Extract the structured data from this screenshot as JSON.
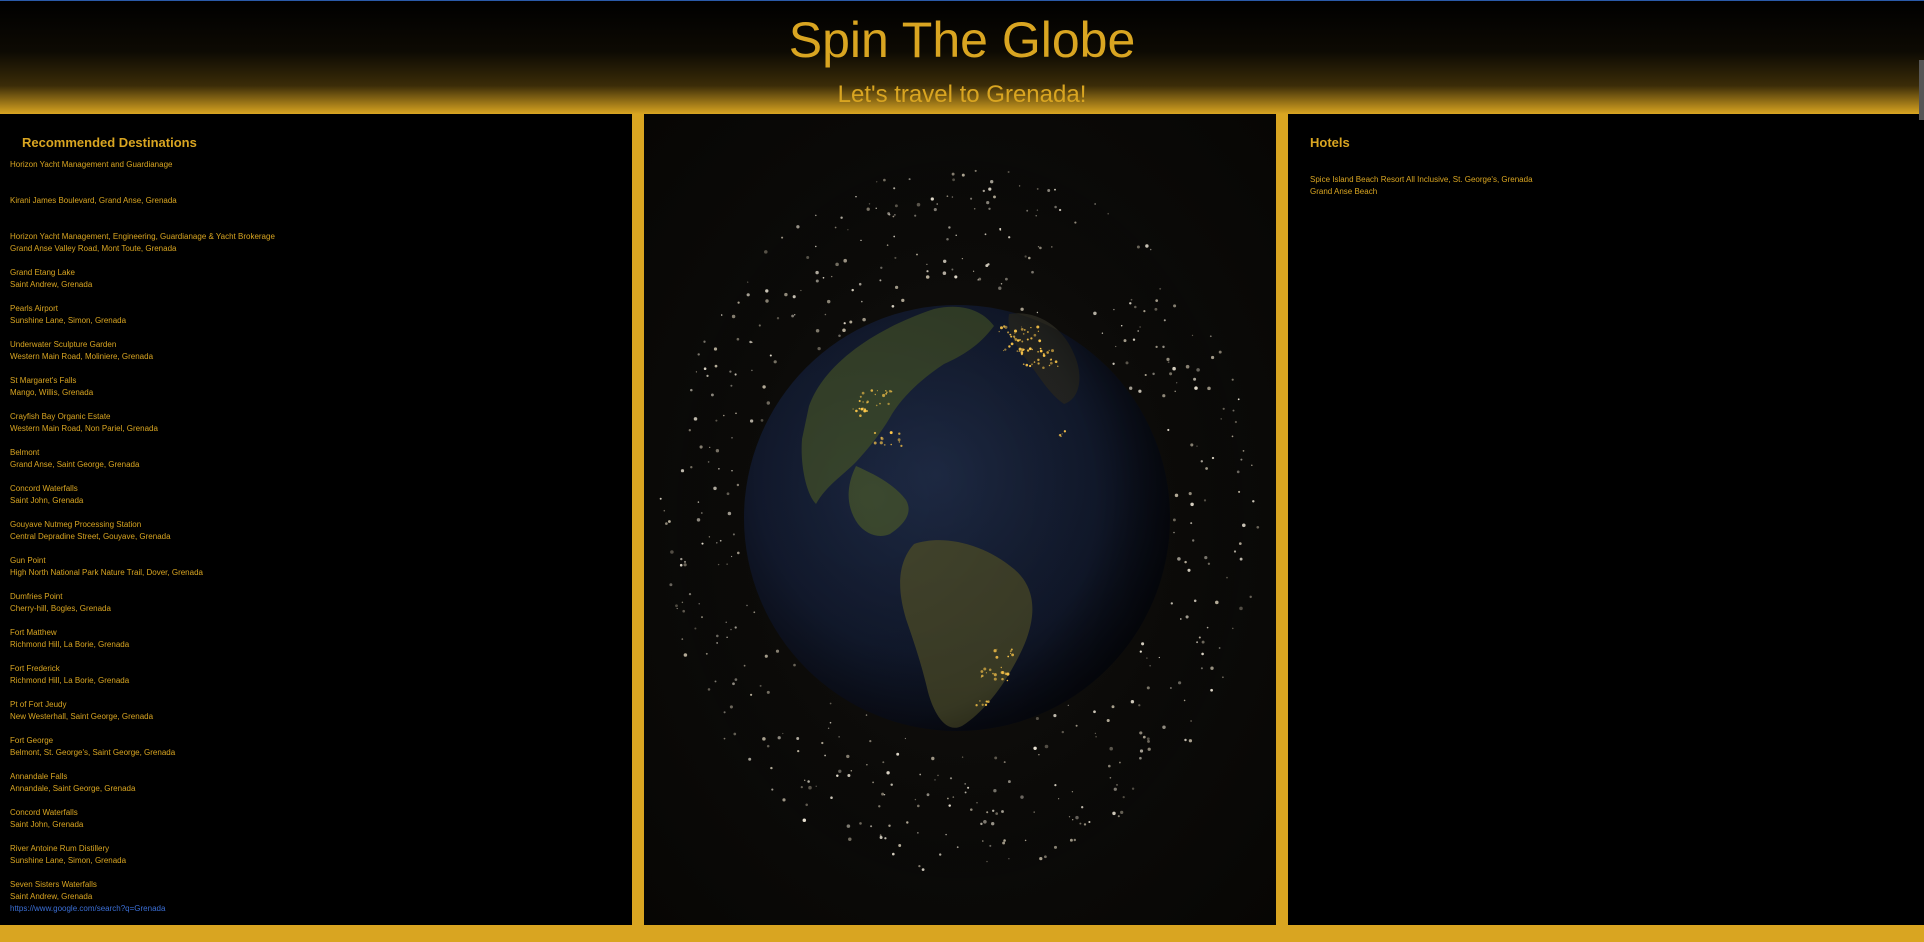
{
  "header": {
    "title": "Spin The Globe",
    "subtitle": "Let's travel to Grenada!"
  },
  "destinations": {
    "heading": "Recommended Destinations",
    "items": [
      {
        "name": "Horizon Yacht Management and Guardianage",
        "address": ""
      },
      {
        "name": "Kirani James Boulevard, Grand Anse, Grenada",
        "address": ""
      },
      {
        "name": "Horizon Yacht Management, Engineering, Guardianage & Yacht Brokerage",
        "address": "Grand Anse Valley Road, Mont Toute, Grenada"
      },
      {
        "name": "Grand Etang Lake",
        "address": "Saint Andrew, Grenada"
      },
      {
        "name": "Pearls Airport",
        "address": "Sunshine Lane, Simon, Grenada"
      },
      {
        "name": "Underwater Sculpture Garden",
        "address": "Western Main Road, Moliniere, Grenada"
      },
      {
        "name": "St Margaret's Falls",
        "address": "Mango, Willis, Grenada"
      },
      {
        "name": "Crayfish Bay Organic Estate",
        "address": "Western Main Road, Non Pariel, Grenada"
      },
      {
        "name": "Belmont",
        "address": "Grand Anse, Saint George, Grenada"
      },
      {
        "name": "Concord Waterfalls",
        "address": "Saint John, Grenada"
      },
      {
        "name": "Gouyave Nutmeg Processing Station",
        "address": "Central Depradine Street, Gouyave, Grenada"
      },
      {
        "name": "Gun Point",
        "address": "High North National Park Nature Trail, Dover, Grenada"
      },
      {
        "name": "Dumfries Point",
        "address": "Cherry-hill, Bogles, Grenada"
      },
      {
        "name": "Fort Matthew",
        "address": "Richmond Hill, La Borie, Grenada"
      },
      {
        "name": "Fort Frederick",
        "address": "Richmond Hill, La Borie, Grenada"
      },
      {
        "name": "Pt of Fort Jeudy",
        "address": "New Westerhall, Saint George, Grenada"
      },
      {
        "name": "Fort George",
        "address": "Belmont, St. George's, Saint George, Grenada"
      },
      {
        "name": "Annandale Falls",
        "address": "Annandale, Saint George, Grenada"
      },
      {
        "name": "Concord Waterfalls",
        "address": "Saint John, Grenada"
      },
      {
        "name": "River Antoine Rum Distillery",
        "address": "Sunshine Lane, Simon, Grenada"
      },
      {
        "name": "Seven Sisters Waterfalls",
        "address": "Saint Andrew, Grenada"
      }
    ],
    "link": "https://www.google.com/search?q=Grenada"
  },
  "hotels": {
    "heading": "Hotels",
    "items": [
      {
        "name": "Spice Island Beach Resort All Inclusive, St. George's, Grenada",
        "desc": "Grand Anse Beach"
      }
    ]
  },
  "colors": {
    "accent": "#d9a521",
    "panel": "#000000",
    "link": "#3b6fd6"
  }
}
